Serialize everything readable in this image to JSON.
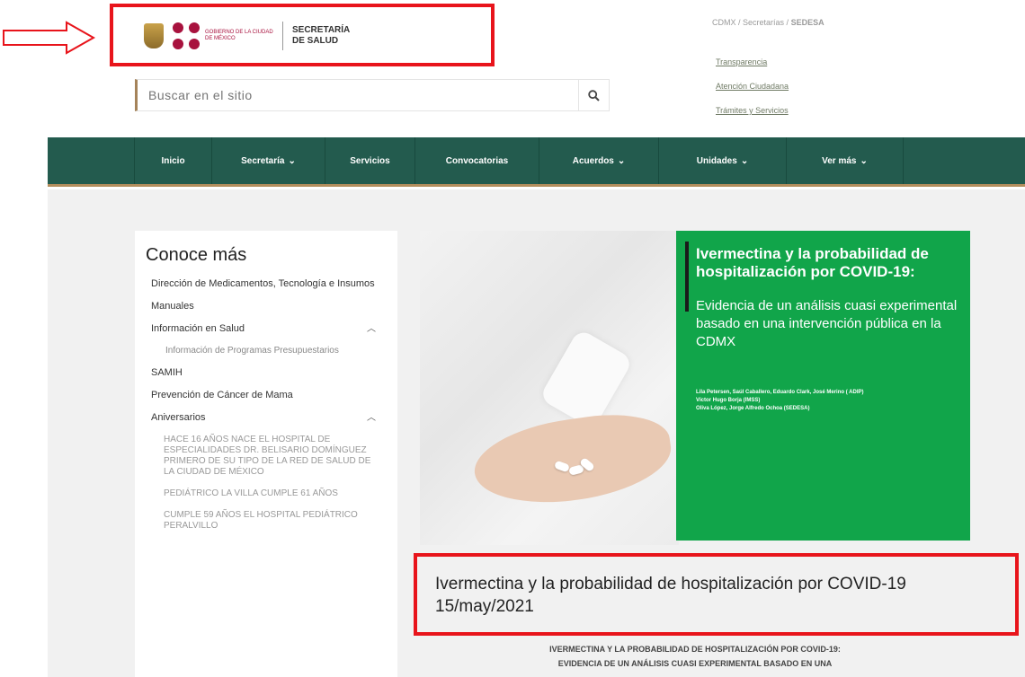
{
  "header": {
    "logo_gob_text": "GOBIERNO DE LA CIUDAD DE MÉXICO",
    "logo_secretaria_line1": "SECRETARÍA",
    "logo_secretaria_line2": "DE SALUD",
    "search_placeholder": "Buscar en el sitio",
    "breadcrumb": {
      "part1": "CDMX",
      "sep1": " / ",
      "part2": "Secretarías",
      "sep2": " / ",
      "current": "SEDESA"
    },
    "top_links": [
      "Transparencia",
      "Atención Ciudadana",
      "Trámites y Servicios"
    ]
  },
  "nav": {
    "items": [
      {
        "label": "Inicio",
        "dropdown": false
      },
      {
        "label": "Secretaría",
        "dropdown": true
      },
      {
        "label": "Servicios",
        "dropdown": false
      },
      {
        "label": "Convocatorias",
        "dropdown": false
      },
      {
        "label": "Acuerdos",
        "dropdown": true
      },
      {
        "label": "Unidades",
        "dropdown": true
      },
      {
        "label": "Ver más",
        "dropdown": true
      }
    ]
  },
  "sidebar": {
    "title": "Conoce más",
    "items": [
      {
        "label": "Dirección de Medicamentos, Tecnología e Insumos"
      },
      {
        "label": "Manuales"
      },
      {
        "label": "Información en Salud",
        "expanded": true,
        "children": [
          "Información de Programas Presupuestarios"
        ]
      },
      {
        "label": "SAMIH"
      },
      {
        "label": "Prevención de Cáncer de Mama"
      },
      {
        "label": "Aniversarios",
        "expanded": true,
        "children": [
          "HACE 16 AÑOS NACE EL HOSPITAL DE ESPECIALIDADES DR. BELISARIO DOMÍNGUEZ PRIMERO DE SU TIPO DE LA RED DE SALUD DE LA CIUDAD DE MÉXICO",
          "PEDIÁTRICO LA VILLA CUMPLE 61 AÑOS",
          "CUMPLE 59 AÑOS EL HOSPITAL PEDIÁTRICO PERALVILLO"
        ]
      }
    ]
  },
  "hero": {
    "title": "Ivermectina y la probabilidad de hospitalización por COVID-19:",
    "subtitle": "Evidencia de un análisis cuasi experimental basado en una intervención pública en la CDMX",
    "authors": [
      "Lila Petersen, Saúl Caballero, Eduardo Clark, José Merino ( ADIP)",
      "Víctor Hugo Borja (IMSS)",
      "Oliva López, Jorge Alfredo Ochoa (SEDESA)"
    ]
  },
  "article": {
    "title": "Ivermectina y la probabilidad de hospitalización por COVID-19 15/may/2021",
    "body_line1": "IVERMECTINA Y LA PROBABILIDAD DE HOSPITALIZACIÓN POR COVID-19:",
    "body_line2": "EVIDENCIA DE UN ANÁLISIS CUASI EXPERIMENTAL BASADO EN UNA"
  },
  "colors": {
    "nav_green": "#235b4e",
    "nav_gold": "#b38e5d",
    "hero_green": "#11a54a",
    "annotation_red": "#e8141b"
  },
  "icons": [
    "arrow-annotation-icon",
    "search-icon",
    "chevron-down-icon",
    "chevron-up-icon"
  ]
}
